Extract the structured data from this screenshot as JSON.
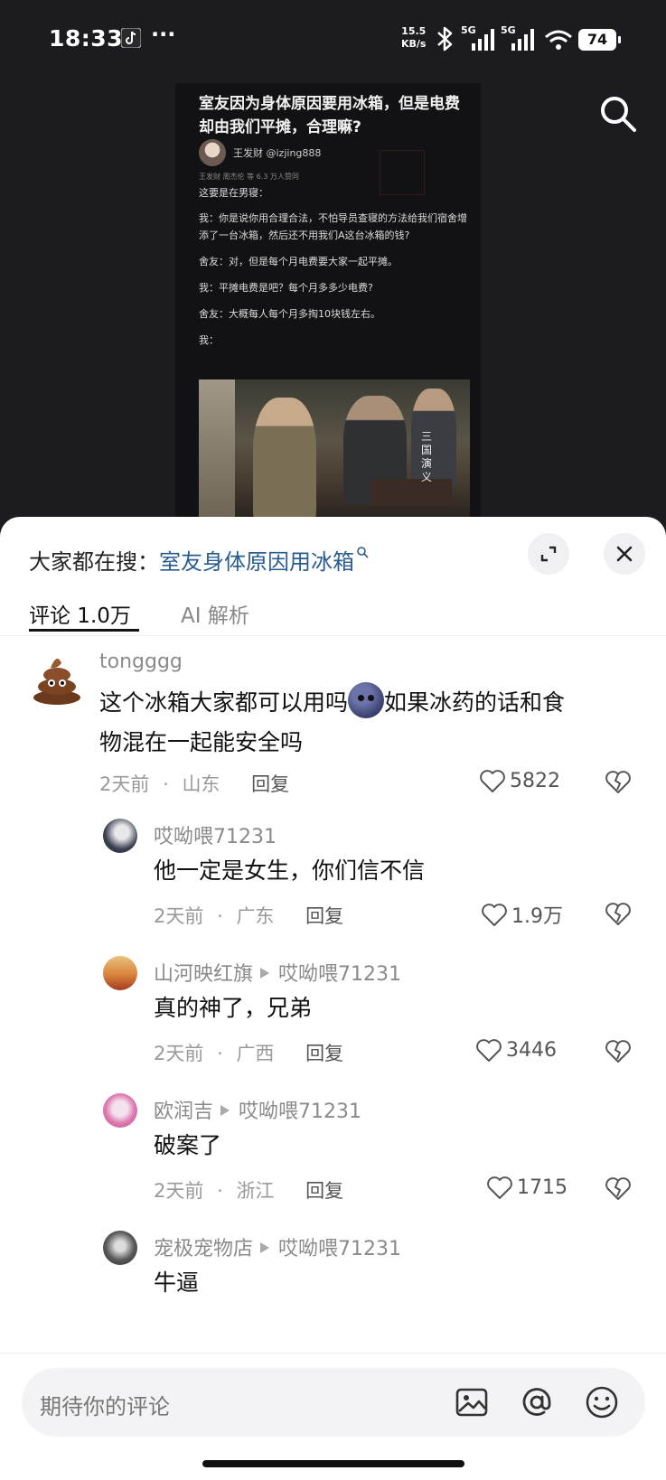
{
  "status_bar": {
    "time": "18:33",
    "more": "···",
    "speed": "15.5",
    "speed_unit": "KB/s",
    "sig1": "5G",
    "sig2": "5G",
    "battery": "74"
  },
  "post": {
    "title": "室友因为身体原因要用冰箱，但是电费却由我们平摊，合理嘛?",
    "author": "王发财 @izjing888",
    "likes_note": "王发财 周杰伦 等 6.3 万人赞同",
    "lines": [
      "这要是在男寝：",
      "我：你是说你用合理合法，不怕导员查寝的方法给我们宿舍增添了一台冰箱，然后还不用我们A这台冰箱的钱?",
      "舍友：对，但是每个月电费要大家一起平摊。",
      "我：平摊电费是吧？每个月多多少电费?",
      "舍友：大概每人每个月多掏10块钱左右。",
      "我："
    ],
    "video_caption": "三国演义"
  },
  "sheet": {
    "hot_prefix": "大家都在搜：",
    "hot_query": "室友身体原因用冰箱",
    "tabs": {
      "comments": "评论 1.0万",
      "ai": "AI 解析"
    }
  },
  "comments": [
    {
      "user": "tongggg",
      "text_before": "这个冰箱大家都可以用吗",
      "text_after": "如果冰药的话和食",
      "text_line2": "物混在一起能安全吗",
      "time": "2天前",
      "location": "山东",
      "reply": "回复",
      "likes": "5822"
    },
    {
      "user": "哎呦喂71231",
      "text": "他一定是女生，你们信不信",
      "time": "2天前",
      "location": "广东",
      "reply": "回复",
      "likes": "1.9万"
    },
    {
      "user": "山河映红旗",
      "reply_to": "哎呦喂71231",
      "text": "真的神了，兄弟",
      "time": "2天前",
      "location": "广西",
      "reply": "回复",
      "likes": "3446"
    },
    {
      "user": "欧润吉",
      "reply_to": "哎呦喂71231",
      "text": "破案了",
      "time": "2天前",
      "location": "浙江",
      "reply": "回复",
      "likes": "1715"
    },
    {
      "user": "宠极宠物店",
      "reply_to": "哎呦喂71231",
      "text": "牛逼"
    }
  ],
  "input": {
    "placeholder": "期待你的评论"
  },
  "separator": "·",
  "colors": {
    "accent_query": "#2a5d8f",
    "sheet_bg": "#ffffff",
    "video_bg": "#1c1c20"
  }
}
